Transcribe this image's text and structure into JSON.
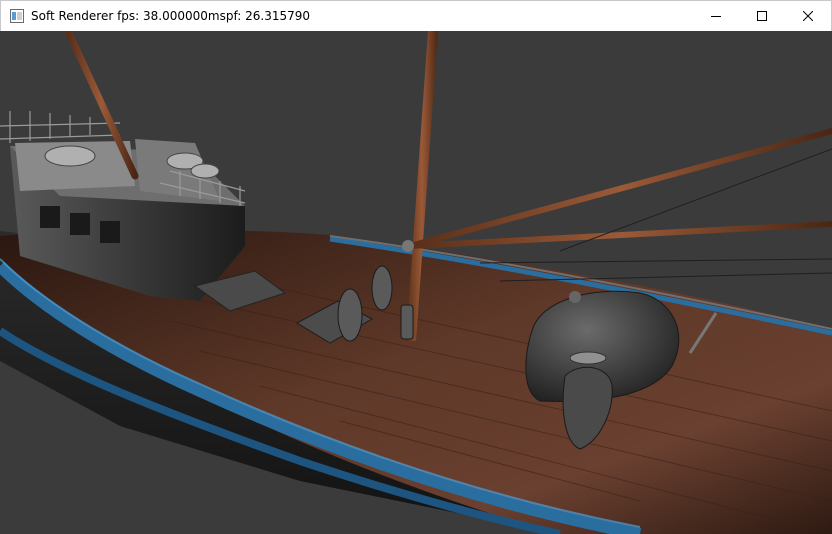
{
  "window": {
    "title": "Soft Renderer fps: 38.000000mspf: 26.315790",
    "icons": {
      "app": "window-app-icon",
      "minimize": "minimize-icon",
      "maximize": "maximize-icon",
      "close": "close-icon"
    }
  },
  "scene": {
    "subject": "fishing boat 3D render",
    "background_color": "#3b3b3b",
    "hull_stripe_color": "#2a6ea0",
    "deck_color": "#5a3526",
    "mast_color": "#8a4a2a"
  }
}
